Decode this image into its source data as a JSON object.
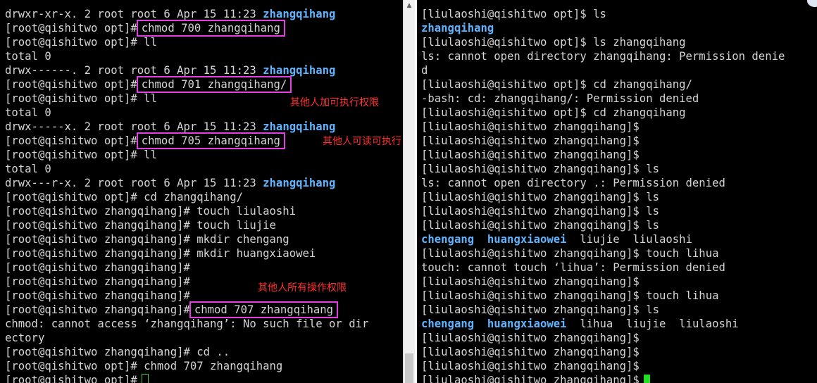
{
  "left": {
    "lines": [
      [
        {
          "t": "drwxr-xr-x. 2 root root 6 Apr 15 11:23 "
        },
        {
          "t": "zhangqihang",
          "c": "dir"
        }
      ],
      [
        {
          "t": "[root@qishitwo opt]#"
        },
        {
          "t": "chmod 700 zhangqihang",
          "c": "hl"
        }
      ],
      [
        {
          "t": "[root@qishitwo opt]# ll"
        }
      ],
      [
        {
          "t": "total 0"
        }
      ],
      [
        {
          "t": "drwx------. 2 root root 6 Apr 15 11:23 "
        },
        {
          "t": "zhangqihang",
          "c": "dir"
        }
      ],
      [
        {
          "t": "[root@qishitwo opt]#"
        },
        {
          "t": "chmod 701 zhangqihang/",
          "c": "hl"
        }
      ],
      [
        {
          "t": "[root@qishitwo opt]# ll"
        }
      ],
      [
        {
          "t": "total 0"
        }
      ],
      [
        {
          "t": "drwx-----x. 2 root root 6 Apr 15 11:23 "
        },
        {
          "t": "zhangqihang",
          "c": "dir"
        }
      ],
      [
        {
          "t": "[root@qishitwo opt]#"
        },
        {
          "t": "chmod 705 zhangqihang",
          "c": "hl"
        }
      ],
      [
        {
          "t": "[root@qishitwo opt]# ll"
        }
      ],
      [
        {
          "t": "total 0"
        }
      ],
      [
        {
          "t": "drwx---r-x. 2 root root 6 Apr 15 11:23 "
        },
        {
          "t": "zhangqihang",
          "c": "dir"
        }
      ],
      [
        {
          "t": "[root@qishitwo opt]# cd zhangqihang/"
        }
      ],
      [
        {
          "t": "[root@qishitwo zhangqihang]# touch liulaoshi"
        }
      ],
      [
        {
          "t": "[root@qishitwo zhangqihang]# touch liujie"
        }
      ],
      [
        {
          "t": "[root@qishitwo zhangqihang]# mkdir chengang"
        }
      ],
      [
        {
          "t": "[root@qishitwo zhangqihang]# mkdir huangxiaowei"
        }
      ],
      [
        {
          "t": "[root@qishitwo zhangqihang]#"
        }
      ],
      [
        {
          "t": "[root@qishitwo zhangqihang]#"
        }
      ],
      [
        {
          "t": "[root@qishitwo zhangqihang]#"
        }
      ],
      [
        {
          "t": "[root@qishitwo zhangqihang]#"
        },
        {
          "t": "chmod 707 zhangqihang",
          "c": "hl"
        }
      ],
      [
        {
          "t": "chmod: cannot access ‘zhangqihang’: No such file or dir"
        }
      ],
      [
        {
          "t": "ectory"
        }
      ],
      [
        {
          "t": "[root@qishitwo zhangqihang]# cd .."
        }
      ],
      [
        {
          "t": "[root@qishitwo opt]# chmod 707 zhangqihang"
        }
      ],
      [
        {
          "t": "[root@qishitwo opt]#"
        },
        {
          "t": "",
          "c": "cursor-left"
        }
      ]
    ],
    "annotations": [
      "其他人加可执行权限",
      "其他人可读可执行",
      "其他人所有操作权限"
    ]
  },
  "right": {
    "lines": [
      [
        {
          "t": "[liulaoshi@qishitwo opt]$ ls"
        }
      ],
      [
        {
          "t": "zhangqihang",
          "c": "dir"
        }
      ],
      [
        {
          "t": "[liulaoshi@qishitwo opt]$ ls zhangqihang"
        }
      ],
      [
        {
          "t": "ls: cannot open directory zhangqihang: Permission denie"
        }
      ],
      [
        {
          "t": "d"
        }
      ],
      [
        {
          "t": "[liulaoshi@qishitwo opt]$ cd zhangqihang/"
        }
      ],
      [
        {
          "t": "-bash: cd: zhangqihang/: Permission denied"
        }
      ],
      [
        {
          "t": "[liulaoshi@qishitwo opt]$ cd zhangqihang"
        }
      ],
      [
        {
          "t": "[liulaoshi@qishitwo zhangqihang]$"
        }
      ],
      [
        {
          "t": "[liulaoshi@qishitwo zhangqihang]$"
        }
      ],
      [
        {
          "t": "[liulaoshi@qishitwo zhangqihang]$"
        }
      ],
      [
        {
          "t": "[liulaoshi@qishitwo zhangqihang]$ ls"
        }
      ],
      [
        {
          "t": "ls: cannot open directory .: Permission denied"
        }
      ],
      [
        {
          "t": "[liulaoshi@qishitwo zhangqihang]$ ls"
        }
      ],
      [
        {
          "t": "[liulaoshi@qishitwo zhangqihang]$ ls"
        }
      ],
      [
        {
          "t": "[liulaoshi@qishitwo zhangqihang]$ ls"
        }
      ],
      [
        {
          "t": "chengang",
          "c": "dir"
        },
        {
          "t": "  "
        },
        {
          "t": "huangxiaowei",
          "c": "dir"
        },
        {
          "t": "  liujie  liulaoshi"
        }
      ],
      [
        {
          "t": "[liulaoshi@qishitwo zhangqihang]$ touch lihua"
        }
      ],
      [
        {
          "t": "touch: cannot touch ‘lihua’: Permission denied"
        }
      ],
      [
        {
          "t": "[liulaoshi@qishitwo zhangqihang]$"
        }
      ],
      [
        {
          "t": "[liulaoshi@qishitwo zhangqihang]$ touch lihua"
        }
      ],
      [
        {
          "t": "[liulaoshi@qishitwo zhangqihang]$ ls"
        }
      ],
      [
        {
          "t": "chengang",
          "c": "dir"
        },
        {
          "t": "  "
        },
        {
          "t": "huangxiaowei",
          "c": "dir"
        },
        {
          "t": "  lihua  liujie  liulaoshi"
        }
      ],
      [
        {
          "t": "[liulaoshi@qishitwo zhangqihang]$"
        }
      ],
      [
        {
          "t": "[liulaoshi@qishitwo zhangqihang]$"
        }
      ],
      [
        {
          "t": "[liulaoshi@qishitwo zhangqihang]$"
        }
      ],
      [
        {
          "t": "[liulaoshi@qishitwo zhangqihang]$"
        },
        {
          "t": "",
          "c": "cursor-right"
        }
      ]
    ]
  },
  "colors": {
    "background": "#000000",
    "text": "#d4d4d4",
    "directory": "#5fb4ff",
    "highlight_box": "#e040e0",
    "annotation": "#ff3030",
    "cursor": "#22dd22"
  }
}
